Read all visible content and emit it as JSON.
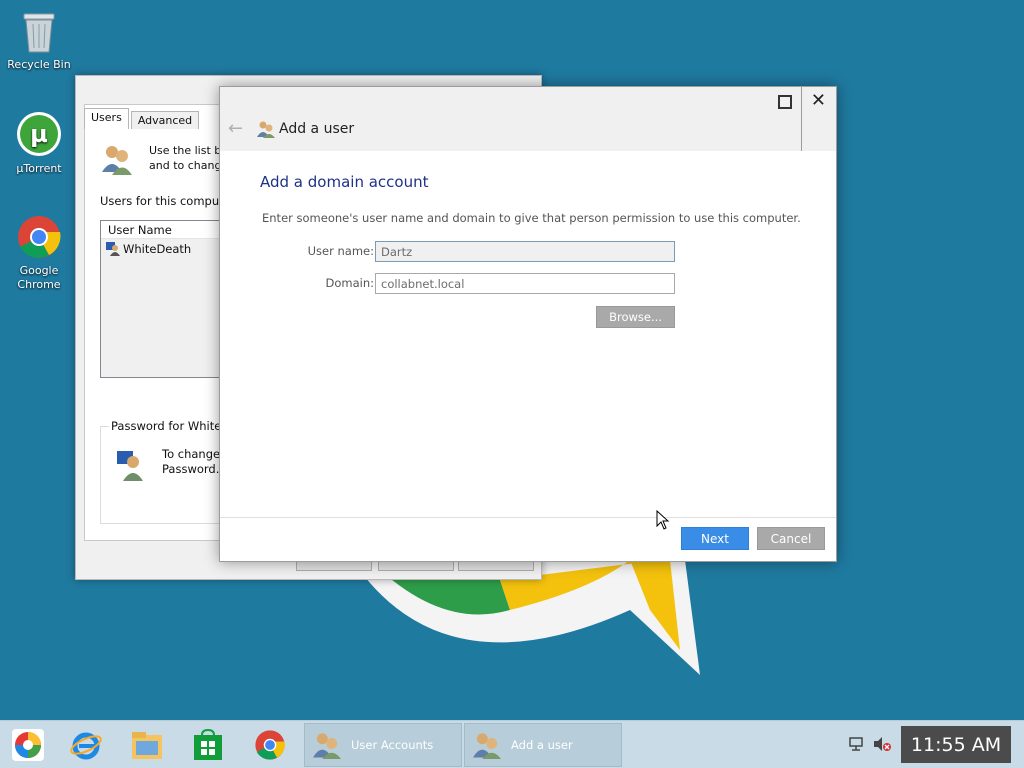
{
  "desktop": {
    "icons": [
      {
        "label": "Recycle Bin",
        "icon": "recycle-bin-icon"
      },
      {
        "label": "µTorrent",
        "icon": "utorrent-icon"
      },
      {
        "label": "Google Chrome",
        "icon": "chrome-icon"
      }
    ]
  },
  "user_accounts_window": {
    "tabs": [
      "Users",
      "Advanced"
    ],
    "description": "Use the list be\nand to chang",
    "users_label": "Users for this compute",
    "column_header": "User Name",
    "users": [
      "WhiteDeath"
    ],
    "password_group_label": "Password for WhiteD",
    "password_text": "To change\nPassword."
  },
  "dialog": {
    "title": "Add a user",
    "heading": "Add a domain account",
    "instructions": "Enter someone's user name and domain to give that person permission to use this computer.",
    "username_label": "User name:",
    "username_value": "Dartz",
    "domain_label": "Domain:",
    "domain_value": "collabnet.local",
    "browse_label": "Browse...",
    "next_label": "Next",
    "cancel_label": "Cancel",
    "colors": {
      "heading": "#1e3287",
      "next_button": "#3a8de6",
      "disabled_button": "#a9a9a9"
    }
  },
  "taskbar": {
    "pinned": [
      "picasa-icon",
      "internet-explorer-icon",
      "file-explorer-icon",
      "store-icon",
      "chrome-icon"
    ],
    "tasks": [
      {
        "label": "User Accounts",
        "icon": "user-accounts-icon"
      },
      {
        "label": "Add a user",
        "icon": "user-accounts-icon"
      }
    ],
    "tray_icons": [
      "network-icon",
      "volume-muted-icon"
    ],
    "clock": "11:55 AM"
  }
}
